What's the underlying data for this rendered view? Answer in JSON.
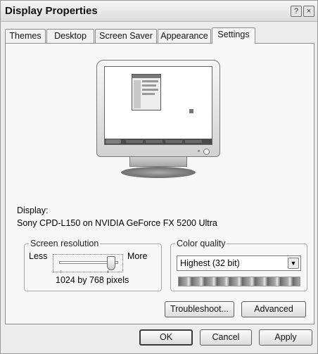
{
  "window": {
    "title": "Display Properties",
    "help_icon": "?",
    "close_icon": "×"
  },
  "tabs": [
    {
      "label": "Themes"
    },
    {
      "label": "Desktop"
    },
    {
      "label": "Screen Saver"
    },
    {
      "label": "Appearance"
    },
    {
      "label": "Settings"
    }
  ],
  "active_tab": "Settings",
  "display": {
    "label": "Display:",
    "value": "Sony CPD-L150 on NVIDIA GeForce FX 5200 Ultra"
  },
  "resolution": {
    "title": "Screen resolution",
    "less": "Less",
    "more": "More",
    "value": "1024 by 768 pixels",
    "slider_level": 0.9
  },
  "color_quality": {
    "title": "Color quality",
    "value": "Highest (32 bit)"
  },
  "buttons": {
    "troubleshoot": "Troubleshoot...",
    "advanced": "Advanced",
    "ok": "OK",
    "cancel": "Cancel",
    "apply": "Apply"
  }
}
